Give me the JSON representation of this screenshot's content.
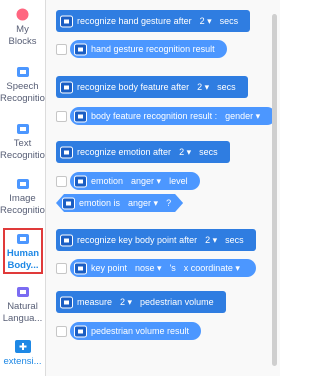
{
  "sidebar": {
    "my_blocks": {
      "line1": "My",
      "line2": "Blocks"
    },
    "speech": {
      "line1": "Speech",
      "line2": "Recognitio"
    },
    "text": {
      "line1": "Text",
      "line2": "Recognitio"
    },
    "image": {
      "line1": "Image",
      "line2": "Recognitio"
    },
    "human": {
      "line1": "Human",
      "line2": "Body..."
    },
    "natural": {
      "line1": "Natural",
      "line2": "Langua..."
    },
    "extension": {
      "line1": "extensi..."
    }
  },
  "blocks": {
    "gesture_cmd": {
      "text": "recognize hand gesture after",
      "value": "2 ▾",
      "suffix": "secs"
    },
    "gesture_result": {
      "text": "hand gesture recognition result"
    },
    "body_cmd": {
      "text": "recognize body feature after",
      "value": "2 ▾",
      "suffix": "secs"
    },
    "body_result": {
      "text": "body feature recognition result :",
      "value": "gender ▾"
    },
    "emotion_cmd": {
      "text": "recognize emotion after",
      "value": "2 ▾",
      "suffix": "secs"
    },
    "emotion_level": {
      "text": "emotion",
      "value": "anger ▾",
      "suffix": "level"
    },
    "emotion_is": {
      "text": "emotion is",
      "value": "anger ▾",
      "suffix": "?"
    },
    "keypoint_cmd": {
      "text": "recognize key body point after",
      "value": "2 ▾",
      "suffix": "secs"
    },
    "keypoint_coord": {
      "text": "key point",
      "value": "nose ▾",
      "mid": "'s",
      "value2": "x coordinate ▾"
    },
    "pedestrian_cmd": {
      "text": "measure",
      "value": "2 ▾",
      "suffix": "pedestrian volume"
    },
    "pedestrian_result": {
      "text": "pedestrian volume result"
    }
  },
  "colors": {
    "block_blue": "#4c97ff",
    "active_border": "#e03a3a",
    "active_text": "#1e88e5"
  }
}
